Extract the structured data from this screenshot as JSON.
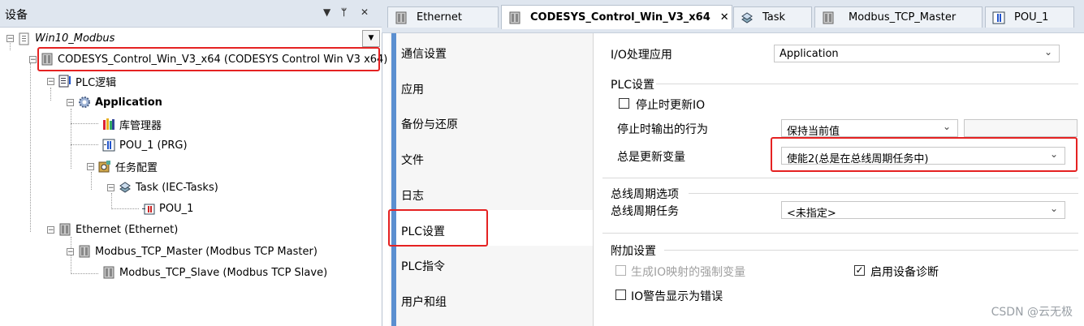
{
  "left_panel": {
    "title": "设备",
    "controls": {
      "dropdown": "▼",
      "pin": "ᛘ",
      "close": "✕"
    },
    "root": "Win10_Modbus",
    "tree": [
      {
        "label": "CODESYS_Control_Win_V3_x64 (CODESYS Control Win V3 x64)",
        "icon": "plc-device-icon"
      },
      {
        "label": "PLC逻辑",
        "icon": "plc-logic-icon"
      },
      {
        "label": "Application",
        "icon": "gear-icon"
      },
      {
        "label": "库管理器",
        "icon": "library-icon"
      },
      {
        "label": "POU_1 (PRG)",
        "icon": "pou-icon"
      },
      {
        "label": "任务配置",
        "icon": "task-config-icon"
      },
      {
        "label": "Task (IEC-Tasks)",
        "icon": "task-icon"
      },
      {
        "label": "POU_1",
        "icon": "pou-call-icon"
      },
      {
        "label": "Ethernet (Ethernet)",
        "icon": "device-icon"
      },
      {
        "label": "Modbus_TCP_Master (Modbus TCP Master)",
        "icon": "device-icon"
      },
      {
        "label": "Modbus_TCP_Slave (Modbus TCP Slave)",
        "icon": "device-icon"
      }
    ]
  },
  "tabs": [
    {
      "label": "Ethernet",
      "icon": "device-icon"
    },
    {
      "label": "CODESYS_Control_Win_V3_x64",
      "icon": "plc-device-icon",
      "close": "✕"
    },
    {
      "label": "Task",
      "icon": "task-icon"
    },
    {
      "label": "Modbus_TCP_Master",
      "icon": "device-icon"
    },
    {
      "label": "POU_1",
      "icon": "pou-icon"
    }
  ],
  "categories": [
    "通信设置",
    "应用",
    "备份与还原",
    "文件",
    "日志",
    "PLC设置",
    "PLC指令",
    "用户和组"
  ],
  "config": {
    "io_app_label": "I/O处理应用",
    "io_app_value": "Application",
    "plc_settings_group": "PLC设置",
    "update_io_on_stop": "停止时更新IO",
    "output_behavior_label": "停止时输出的行为",
    "output_behavior_value": "保持当前值",
    "always_update_label": "总是更新变量",
    "always_update_value": "使能2(总是在总线周期任务中)",
    "bus_cycle_group": "总线周期选项",
    "bus_cycle_task_label": "总线周期任务",
    "bus_cycle_task_value": "<未指定>",
    "extra_group": "附加设置",
    "force_vars": "生成IO映射的强制变量",
    "enable_diag": "启用设备诊断",
    "io_warning_error": "IO警告显示为错误",
    "check": "✓",
    "arrow": "⌄"
  },
  "watermark": "CSDN @云无极",
  "colors": {
    "highlight": "#e52222",
    "accent": "#5b8fd0"
  }
}
